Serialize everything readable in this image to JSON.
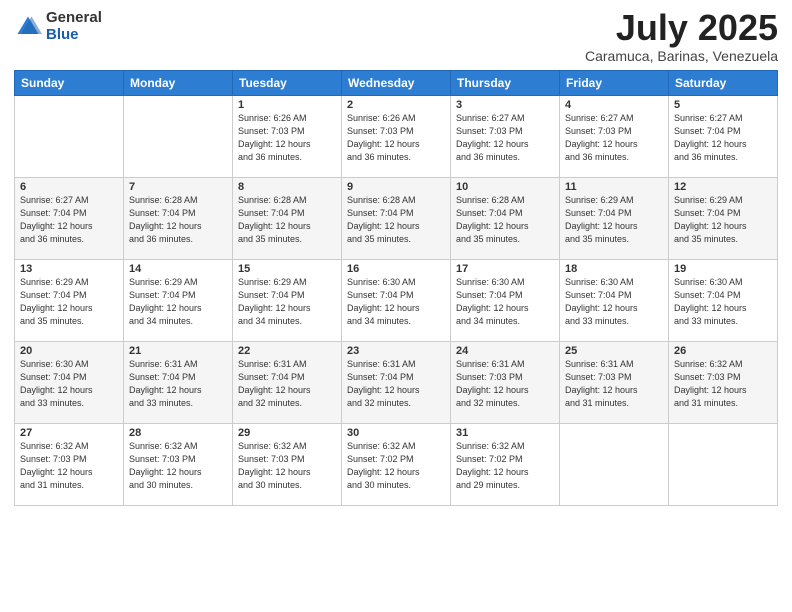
{
  "header": {
    "logo_general": "General",
    "logo_blue": "Blue",
    "month_title": "July 2025",
    "location": "Caramuca, Barinas, Venezuela"
  },
  "days_of_week": [
    "Sunday",
    "Monday",
    "Tuesday",
    "Wednesday",
    "Thursday",
    "Friday",
    "Saturday"
  ],
  "weeks": [
    [
      {
        "day": "",
        "sunrise": "",
        "sunset": "",
        "daylight": ""
      },
      {
        "day": "",
        "sunrise": "",
        "sunset": "",
        "daylight": ""
      },
      {
        "day": "1",
        "sunrise": "Sunrise: 6:26 AM",
        "sunset": "Sunset: 7:03 PM",
        "daylight": "Daylight: 12 hours and 36 minutes."
      },
      {
        "day": "2",
        "sunrise": "Sunrise: 6:26 AM",
        "sunset": "Sunset: 7:03 PM",
        "daylight": "Daylight: 12 hours and 36 minutes."
      },
      {
        "day": "3",
        "sunrise": "Sunrise: 6:27 AM",
        "sunset": "Sunset: 7:03 PM",
        "daylight": "Daylight: 12 hours and 36 minutes."
      },
      {
        "day": "4",
        "sunrise": "Sunrise: 6:27 AM",
        "sunset": "Sunset: 7:03 PM",
        "daylight": "Daylight: 12 hours and 36 minutes."
      },
      {
        "day": "5",
        "sunrise": "Sunrise: 6:27 AM",
        "sunset": "Sunset: 7:04 PM",
        "daylight": "Daylight: 12 hours and 36 minutes."
      }
    ],
    [
      {
        "day": "6",
        "sunrise": "Sunrise: 6:27 AM",
        "sunset": "Sunset: 7:04 PM",
        "daylight": "Daylight: 12 hours and 36 minutes."
      },
      {
        "day": "7",
        "sunrise": "Sunrise: 6:28 AM",
        "sunset": "Sunset: 7:04 PM",
        "daylight": "Daylight: 12 hours and 36 minutes."
      },
      {
        "day": "8",
        "sunrise": "Sunrise: 6:28 AM",
        "sunset": "Sunset: 7:04 PM",
        "daylight": "Daylight: 12 hours and 35 minutes."
      },
      {
        "day": "9",
        "sunrise": "Sunrise: 6:28 AM",
        "sunset": "Sunset: 7:04 PM",
        "daylight": "Daylight: 12 hours and 35 minutes."
      },
      {
        "day": "10",
        "sunrise": "Sunrise: 6:28 AM",
        "sunset": "Sunset: 7:04 PM",
        "daylight": "Daylight: 12 hours and 35 minutes."
      },
      {
        "day": "11",
        "sunrise": "Sunrise: 6:29 AM",
        "sunset": "Sunset: 7:04 PM",
        "daylight": "Daylight: 12 hours and 35 minutes."
      },
      {
        "day": "12",
        "sunrise": "Sunrise: 6:29 AM",
        "sunset": "Sunset: 7:04 PM",
        "daylight": "Daylight: 12 hours and 35 minutes."
      }
    ],
    [
      {
        "day": "13",
        "sunrise": "Sunrise: 6:29 AM",
        "sunset": "Sunset: 7:04 PM",
        "daylight": "Daylight: 12 hours and 35 minutes."
      },
      {
        "day": "14",
        "sunrise": "Sunrise: 6:29 AM",
        "sunset": "Sunset: 7:04 PM",
        "daylight": "Daylight: 12 hours and 34 minutes."
      },
      {
        "day": "15",
        "sunrise": "Sunrise: 6:29 AM",
        "sunset": "Sunset: 7:04 PM",
        "daylight": "Daylight: 12 hours and 34 minutes."
      },
      {
        "day": "16",
        "sunrise": "Sunrise: 6:30 AM",
        "sunset": "Sunset: 7:04 PM",
        "daylight": "Daylight: 12 hours and 34 minutes."
      },
      {
        "day": "17",
        "sunrise": "Sunrise: 6:30 AM",
        "sunset": "Sunset: 7:04 PM",
        "daylight": "Daylight: 12 hours and 34 minutes."
      },
      {
        "day": "18",
        "sunrise": "Sunrise: 6:30 AM",
        "sunset": "Sunset: 7:04 PM",
        "daylight": "Daylight: 12 hours and 33 minutes."
      },
      {
        "day": "19",
        "sunrise": "Sunrise: 6:30 AM",
        "sunset": "Sunset: 7:04 PM",
        "daylight": "Daylight: 12 hours and 33 minutes."
      }
    ],
    [
      {
        "day": "20",
        "sunrise": "Sunrise: 6:30 AM",
        "sunset": "Sunset: 7:04 PM",
        "daylight": "Daylight: 12 hours and 33 minutes."
      },
      {
        "day": "21",
        "sunrise": "Sunrise: 6:31 AM",
        "sunset": "Sunset: 7:04 PM",
        "daylight": "Daylight: 12 hours and 33 minutes."
      },
      {
        "day": "22",
        "sunrise": "Sunrise: 6:31 AM",
        "sunset": "Sunset: 7:04 PM",
        "daylight": "Daylight: 12 hours and 32 minutes."
      },
      {
        "day": "23",
        "sunrise": "Sunrise: 6:31 AM",
        "sunset": "Sunset: 7:04 PM",
        "daylight": "Daylight: 12 hours and 32 minutes."
      },
      {
        "day": "24",
        "sunrise": "Sunrise: 6:31 AM",
        "sunset": "Sunset: 7:03 PM",
        "daylight": "Daylight: 12 hours and 32 minutes."
      },
      {
        "day": "25",
        "sunrise": "Sunrise: 6:31 AM",
        "sunset": "Sunset: 7:03 PM",
        "daylight": "Daylight: 12 hours and 31 minutes."
      },
      {
        "day": "26",
        "sunrise": "Sunrise: 6:32 AM",
        "sunset": "Sunset: 7:03 PM",
        "daylight": "Daylight: 12 hours and 31 minutes."
      }
    ],
    [
      {
        "day": "27",
        "sunrise": "Sunrise: 6:32 AM",
        "sunset": "Sunset: 7:03 PM",
        "daylight": "Daylight: 12 hours and 31 minutes."
      },
      {
        "day": "28",
        "sunrise": "Sunrise: 6:32 AM",
        "sunset": "Sunset: 7:03 PM",
        "daylight": "Daylight: 12 hours and 30 minutes."
      },
      {
        "day": "29",
        "sunrise": "Sunrise: 6:32 AM",
        "sunset": "Sunset: 7:03 PM",
        "daylight": "Daylight: 12 hours and 30 minutes."
      },
      {
        "day": "30",
        "sunrise": "Sunrise: 6:32 AM",
        "sunset": "Sunset: 7:02 PM",
        "daylight": "Daylight: 12 hours and 30 minutes."
      },
      {
        "day": "31",
        "sunrise": "Sunrise: 6:32 AM",
        "sunset": "Sunset: 7:02 PM",
        "daylight": "Daylight: 12 hours and 29 minutes."
      },
      {
        "day": "",
        "sunrise": "",
        "sunset": "",
        "daylight": ""
      },
      {
        "day": "",
        "sunrise": "",
        "sunset": "",
        "daylight": ""
      }
    ]
  ]
}
